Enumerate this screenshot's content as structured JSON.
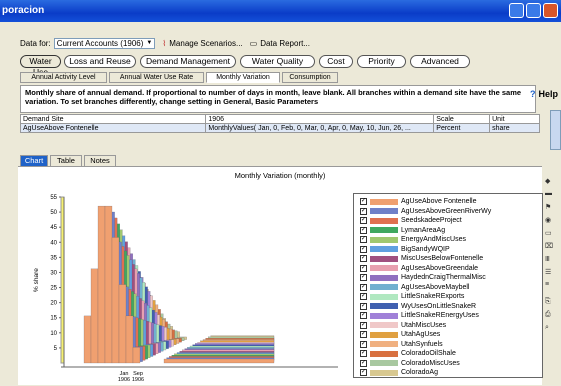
{
  "window": {
    "title": "poracion"
  },
  "toolbar": {
    "data_for_label": "Data for:",
    "data_for_value": "Current Accounts (1906)",
    "manage_scenarios": "Manage Scenarios...",
    "data_report": "Data Report..."
  },
  "main_tabs": [
    "Water Use",
    "Loss and Reuse",
    "Demand Management",
    "Water Quality",
    "Cost",
    "Priority",
    "Advanced"
  ],
  "sub_tabs": [
    "Annual Activity Level",
    "Annual Water Use Rate",
    "Monthly Variation",
    "Consumption"
  ],
  "description": "Monthly share of annual demand. If proportional to number of days in month, leave blank. All branches within a demand site have the same variation. To set branches differently, change setting in General, Basic Parameters",
  "help_label": "Help",
  "grid": {
    "header": [
      "Demand Site",
      "1906",
      "Scale",
      "Unit"
    ],
    "row": [
      "AgUseAbove Fontenelle",
      "MonthlyValues( Jan, 0, Feb, 0, Mar, 0, Apr, 0, May, 10, Jun, 26, ...",
      "Percent",
      "share"
    ]
  },
  "chart_tabs": [
    "Chart",
    "Table",
    "Notes"
  ],
  "chart_data": {
    "type": "bar",
    "title": "Monthly Variation (monthly)",
    "ylabel": "% share",
    "ylim": [
      0,
      55
    ],
    "yticks": [
      5,
      10,
      15,
      20,
      25,
      30,
      35,
      40,
      45,
      50,
      55
    ],
    "xticks": [
      "Jan",
      "Sep"
    ],
    "xtick_years": [
      "1906",
      "1906"
    ],
    "series": [
      {
        "name": "AgUseAbove Fontenelle",
        "color": "#f0a070"
      },
      {
        "name": "AgUsesAboveGreenRiverWy",
        "color": "#7080c8"
      },
      {
        "name": "SeedskadeeProject",
        "color": "#e07050"
      },
      {
        "name": "LymanAreaAg",
        "color": "#40a860"
      },
      {
        "name": "EnergyAndMiscUses",
        "color": "#a0c870"
      },
      {
        "name": "BigSandyWQIP",
        "color": "#60a0e0"
      },
      {
        "name": "MiscUsesBelowFontenelle",
        "color": "#a05080"
      },
      {
        "name": "AgUsesAboveGreendale",
        "color": "#e8a0b0"
      },
      {
        "name": "HaydednCraigThermalMisc",
        "color": "#9070c0"
      },
      {
        "name": "AgUsesAboveMaybell",
        "color": "#70b0d0"
      },
      {
        "name": "LittleSnakeRExports",
        "color": "#b0e8c0"
      },
      {
        "name": "WyUsesOnLittleSnakeR",
        "color": "#4060b0"
      },
      {
        "name": "LittleSnakeREnergyUses",
        "color": "#a080d8"
      },
      {
        "name": "UtahMiscUses",
        "color": "#f0c8c8"
      },
      {
        "name": "UtahAgUses",
        "color": "#e0a040"
      },
      {
        "name": "UtahSynfuels",
        "color": "#f0b080"
      },
      {
        "name": "ColoradoOilShale",
        "color": "#d87040"
      },
      {
        "name": "ColoradoMiscUses",
        "color": "#a8c8a0"
      },
      {
        "name": "ColoradoAg",
        "color": "#d8c890"
      }
    ]
  }
}
